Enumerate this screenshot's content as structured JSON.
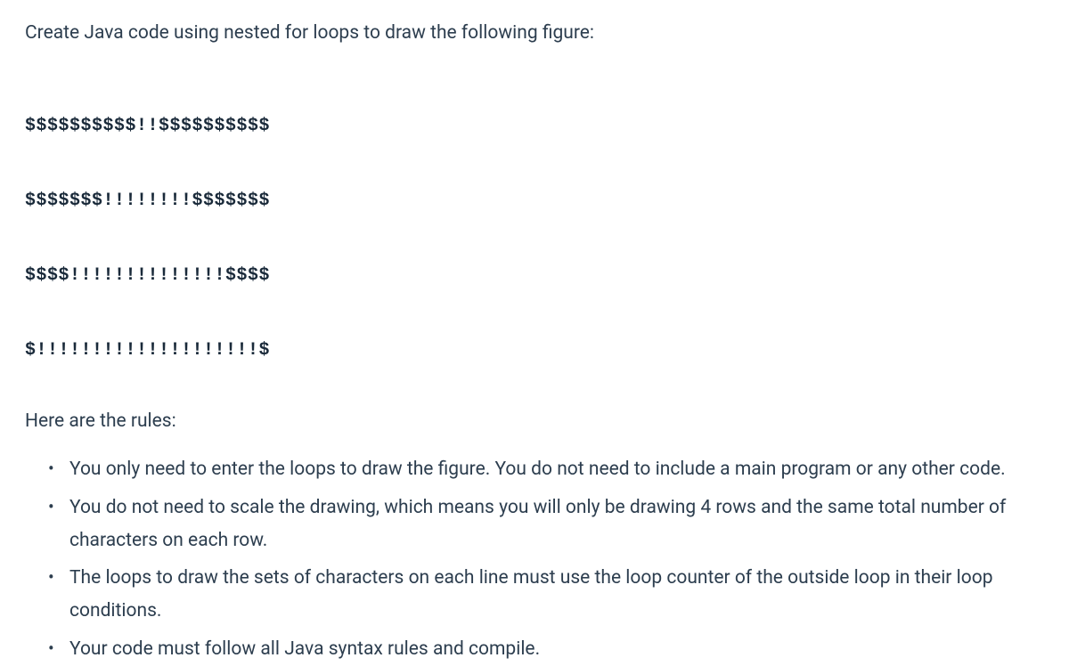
{
  "intro": "Create Java code using nested for loops to draw the following figure:",
  "figure_lines": [
    "$$$$$$$$$$!!$$$$$$$$$$",
    "$$$$$$$!!!!!!!!$$$$$$$",
    "$$$$!!!!!!!!!!!!!!$$$$",
    "$!!!!!!!!!!!!!!!!!!!!$"
  ],
  "rules_heading": "Here are the rules:",
  "rules": [
    "You only need to enter the loops to draw the figure. You do not need to include a main program or any other code.",
    "You do not need to scale the drawing, which means you will only be drawing 4 rows and the same total number of characters on each row.",
    "The loops to draw the sets of characters on each line must use the loop counter of the outside loop in their loop conditions.",
    "Your code must follow all Java syntax rules and compile."
  ]
}
